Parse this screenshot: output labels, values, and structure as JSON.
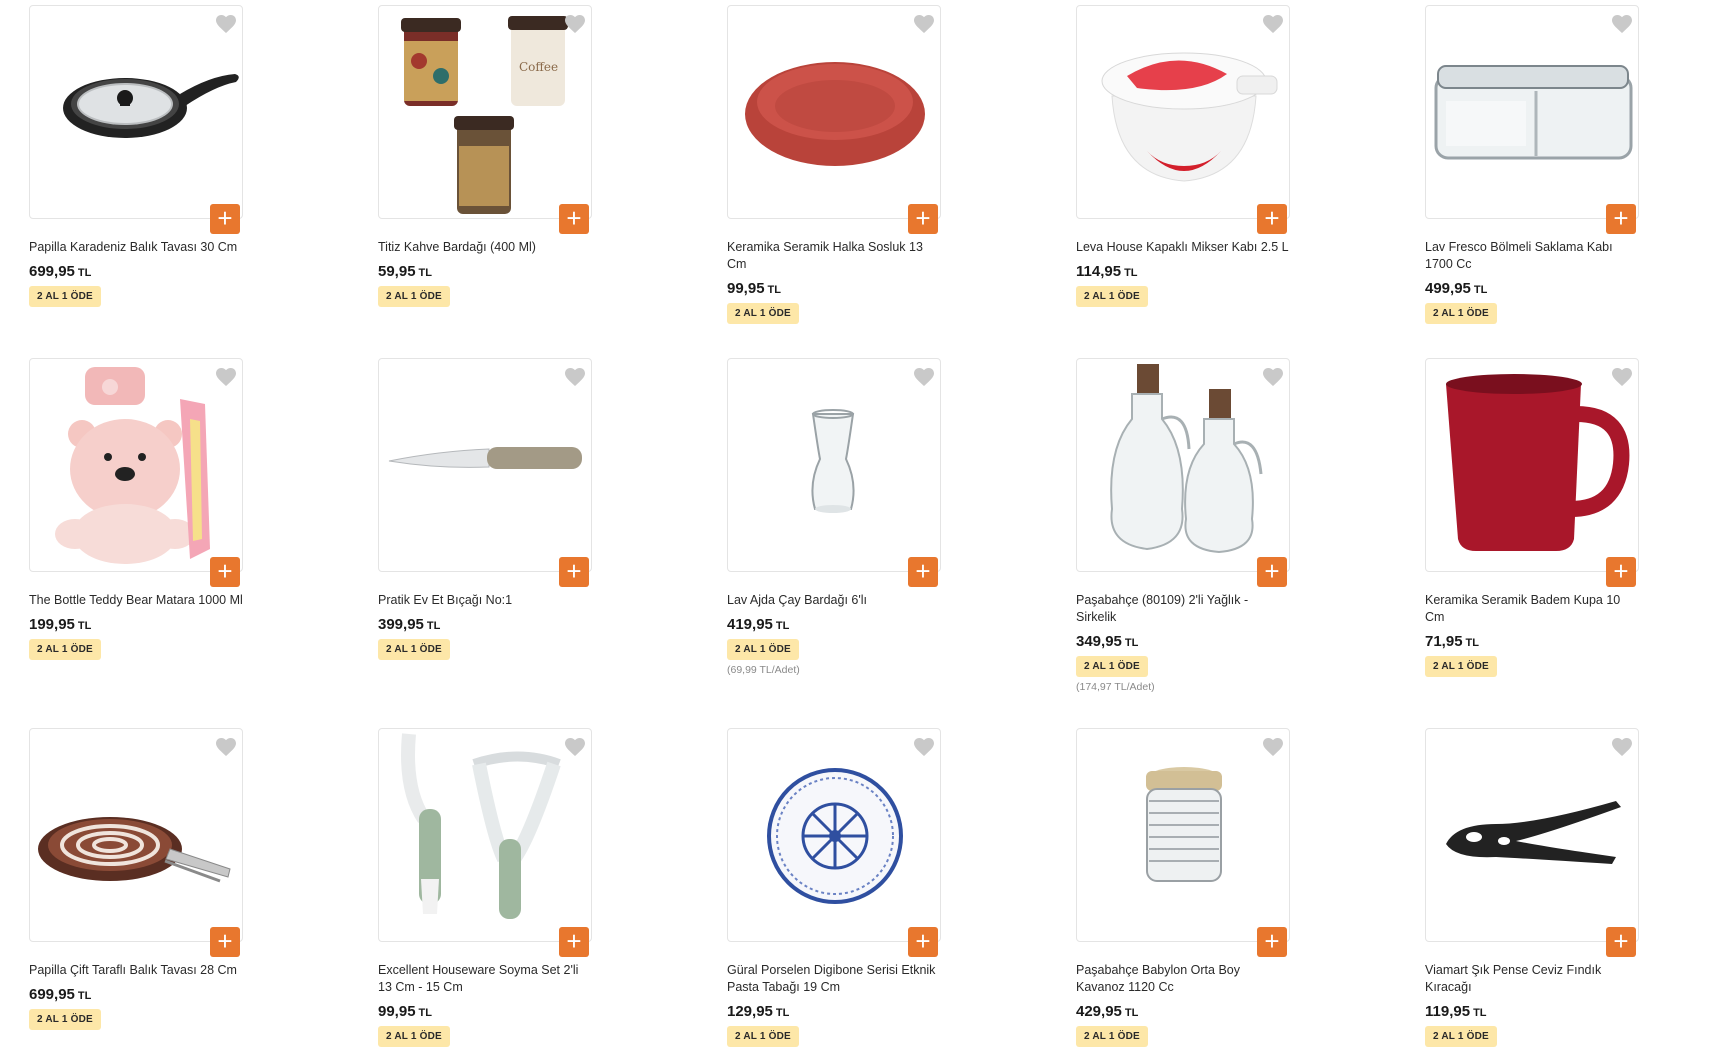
{
  "products": [
    {
      "name": "Papilla Karadeniz Balık Tavası 30 Cm",
      "price": "699,95",
      "currency": "TL",
      "badge": "2 AL 1 ÖDE",
      "unit_price": "",
      "image": "frying-pan-glass-lid"
    },
    {
      "name": "Titiz Kahve Bardağı (400 Ml)",
      "price": "59,95",
      "currency": "TL",
      "badge": "2 AL 1 ÖDE",
      "unit_price": "",
      "image": "coffee-cups"
    },
    {
      "name": "Keramika Seramik Halka Sosluk 13 Cm",
      "price": "99,95",
      "currency": "TL",
      "badge": "2 AL 1 ÖDE",
      "unit_price": "",
      "image": "red-bowl"
    },
    {
      "name": "Leva House Kapaklı Mikser Kabı 2.5 L",
      "price": "114,95",
      "currency": "TL",
      "badge": "2 AL 1 ÖDE",
      "unit_price": "",
      "image": "mixer-bowl"
    },
    {
      "name": "Lav Fresco Bölmeli Saklama Kabı 1700 Cc",
      "price": "499,95",
      "currency": "TL",
      "badge": "2 AL 1 ÖDE",
      "unit_price": "",
      "image": "glass-container"
    },
    {
      "name": "The Bottle Teddy Bear Matara 1000 Ml",
      "price": "199,95",
      "currency": "TL",
      "badge": "2 AL 1 ÖDE",
      "unit_price": "",
      "image": "teddy-bottle"
    },
    {
      "name": "Pratik Ev Et Bıçağı No:1",
      "price": "399,95",
      "currency": "TL",
      "badge": "2 AL 1 ÖDE",
      "unit_price": "",
      "image": "knife"
    },
    {
      "name": "Lav Ajda Çay Bardağı 6'lı",
      "price": "419,95",
      "currency": "TL",
      "badge": "2 AL 1 ÖDE",
      "unit_price": "(69,99 TL/Adet)",
      "image": "tea-glass"
    },
    {
      "name": "Paşabahçe (80109) 2'li Yağlık - Sirkelik",
      "price": "349,95",
      "currency": "TL",
      "badge": "2 AL 1 ÖDE",
      "unit_price": "(174,97 TL/Adet)",
      "image": "oil-bottles"
    },
    {
      "name": "Keramika Seramik Badem Kupa 10 Cm",
      "price": "71,95",
      "currency": "TL",
      "badge": "2 AL 1 ÖDE",
      "unit_price": "",
      "image": "red-mug"
    },
    {
      "name": "Papilla Çift Taraflı Balık Tavası 28 Cm",
      "price": "699,95",
      "currency": "TL",
      "badge": "2 AL 1 ÖDE",
      "unit_price": "",
      "image": "double-pan"
    },
    {
      "name": "Excellent Houseware Soyma Set 2'li 13 Cm - 15 Cm",
      "price": "99,95",
      "currency": "TL",
      "badge": "2 AL 1 ÖDE",
      "unit_price": "",
      "image": "peelers"
    },
    {
      "name": "Güral Porselen Digibone Serisi Etknik Pasta Tabağı 19 Cm",
      "price": "129,95",
      "currency": "TL",
      "badge": "2 AL 1 ÖDE",
      "unit_price": "",
      "image": "patterned-plate"
    },
    {
      "name": "Paşabahçe Babylon Orta Boy Kavanoz 1120 Cc",
      "price": "429,95",
      "currency": "TL",
      "badge": "2 AL 1 ÖDE",
      "unit_price": "",
      "image": "glass-jar"
    },
    {
      "name": "Viamart Şık Pense Ceviz Fındık Kıracağı",
      "price": "119,95",
      "currency": "TL",
      "badge": "2 AL 1 ÖDE",
      "unit_price": "",
      "image": "nutcracker"
    }
  ],
  "icons": {
    "favorite": "heart-icon",
    "add_to_cart": "plus-icon"
  },
  "colors": {
    "add_button": "#e8772e",
    "badge_bg": "#fde7a8",
    "heart": "#c9c9c9"
  }
}
